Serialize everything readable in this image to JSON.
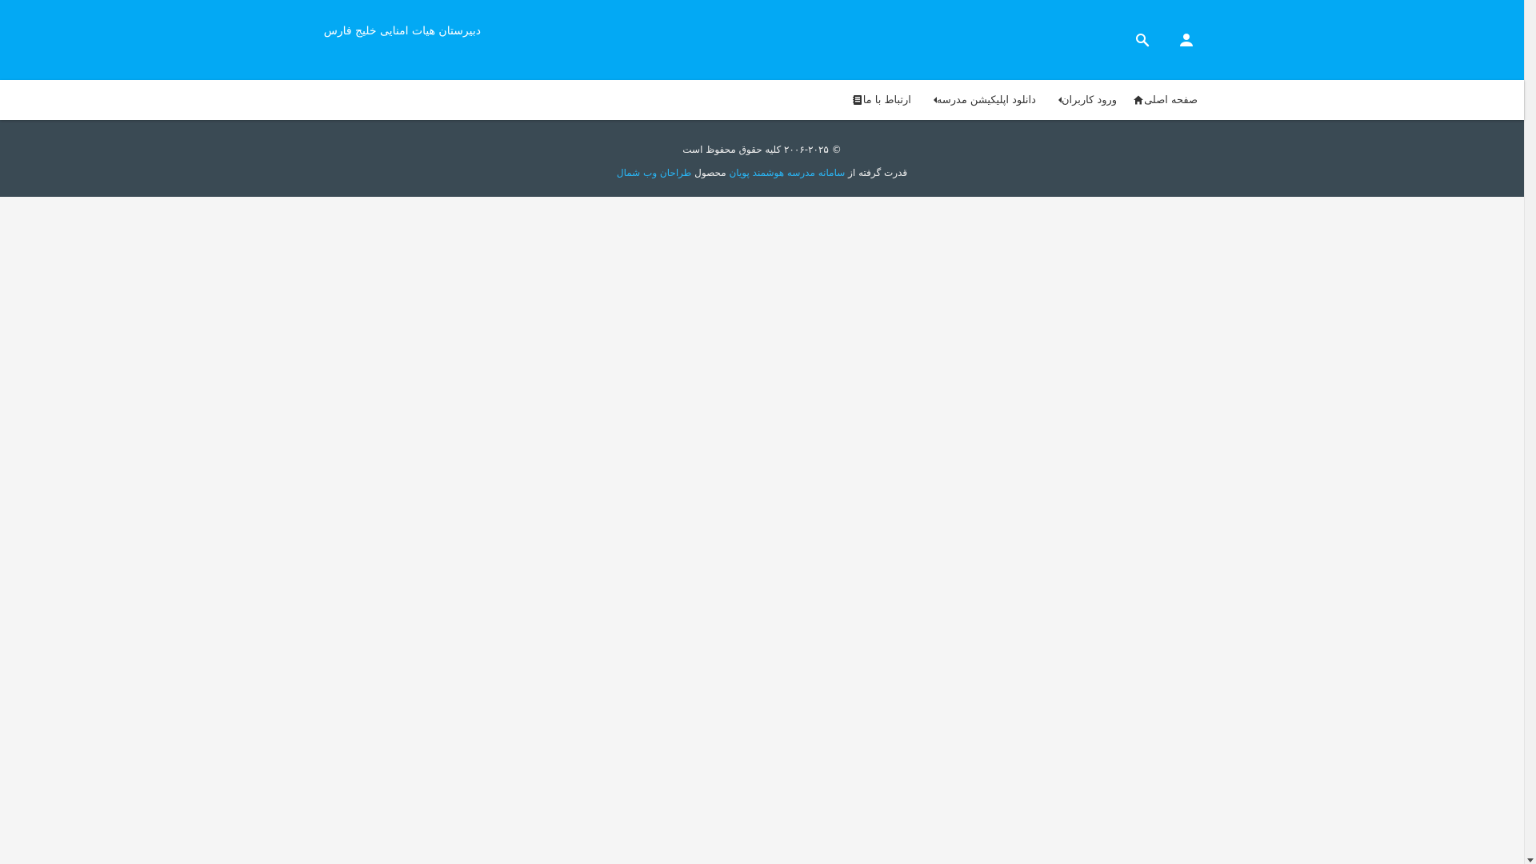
{
  "header": {
    "site_title": "دبیرستان هیات امنایی خلیج فارس",
    "background_color": "#03a9f4",
    "icons": [
      "user-icon",
      "search-icon"
    ]
  },
  "nav": {
    "items": [
      {
        "label": "صفحه اصلی",
        "icon": "home-icon",
        "has_dropdown": false
      },
      {
        "label": "ورود کاربران",
        "icon": "caret-left-icon",
        "has_dropdown": true
      },
      {
        "label": "دانلود اپلیکیشن مدرسه",
        "icon": "caret-left-icon",
        "has_dropdown": true
      },
      {
        "label": "ارتباط با ما",
        "icon": "contact-book-icon",
        "has_dropdown": false
      }
    ]
  },
  "footer": {
    "copyright": "© ۲۰۰۶-۲۰۲۵ کلیه حقوق محفوظ است",
    "powered_prefix": "قدرت گرفته از",
    "product_link": "سامانه مدرسه هوشمند پویان",
    "product_word": "محصول",
    "company_link": "طراحان وب شمال",
    "background_color": "#3a4a54",
    "link_color": "#29b6f6"
  }
}
